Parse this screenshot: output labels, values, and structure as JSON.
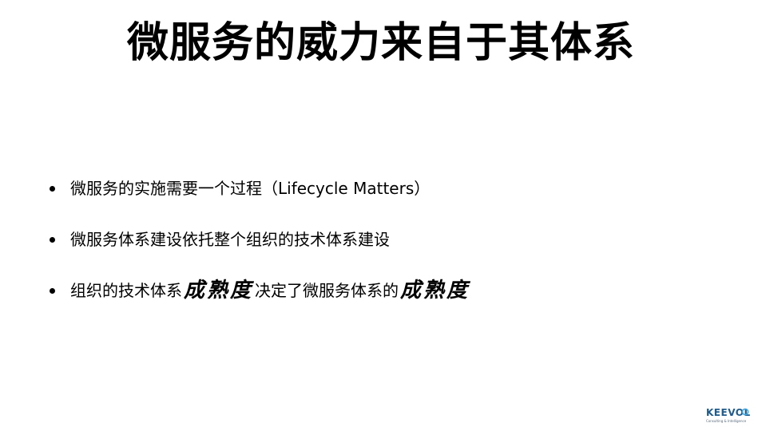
{
  "slide": {
    "title": "微服务的威力来自于其体系",
    "bullets": [
      {
        "text": "微服务的实施需要一个过程（Lifecycle Matters）"
      },
      {
        "text": "微服务体系建设依托整个组织的技术体系建设"
      },
      {
        "part1": "组织的技术体系",
        "emphasis1": "成熟度",
        "part2": "决定了微服务体系的",
        "emphasis2": "成熟度"
      }
    ]
  },
  "logo": {
    "wordmark": "KEEVOL",
    "tagline": "Consulting & Intelligence",
    "color": "#1e5a8c",
    "accent": "#3fa9e0"
  }
}
